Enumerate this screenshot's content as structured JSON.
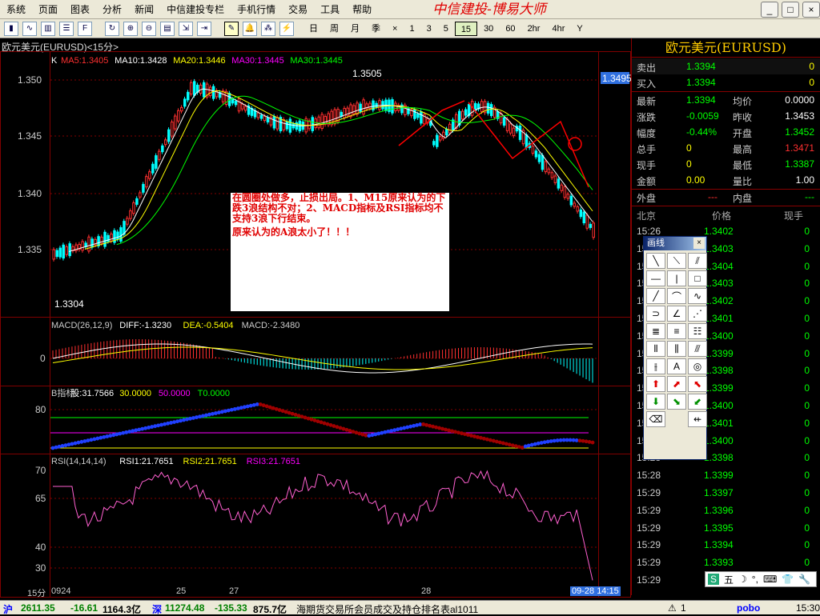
{
  "menu": [
    "系统",
    "页面",
    "图表",
    "分析",
    "新闻",
    "中信建投专栏",
    "手机行情",
    "交易",
    "工具",
    "帮助"
  ],
  "brand": "中信建投-博易大师",
  "window_buttons": [
    "_",
    "□",
    "×"
  ],
  "periods": [
    "日",
    "周",
    "月",
    "季",
    "×",
    "1",
    "3",
    "5",
    "15",
    "30",
    "60",
    "2hr",
    "4hr",
    "Y"
  ],
  "selected_period": "15",
  "chart": {
    "title": "欧元美元(EURUSD)<15分>",
    "ma_legend": [
      {
        "text": "K",
        "color": "#ffffff"
      },
      {
        "text": "MA5:1.3405",
        "color": "#ff3030"
      },
      {
        "text": "MA10:1.3428",
        "color": "#ffffff"
      },
      {
        "text": "MA20:1.3446",
        "color": "#ffff00"
      },
      {
        "text": "MA30:1.3445",
        "color": "#ff00ff"
      },
      {
        "text": "MA30:1.3445",
        "color": "#00ff00"
      }
    ],
    "price_axis": [
      "1.350",
      "1.345",
      "1.340",
      "1.335"
    ],
    "last_price_tag": "1.3495",
    "high_label": "1.3505",
    "low_label": "1.3304",
    "macd_legend": [
      {
        "text": "MACD(26,12,9)",
        "color": "#cccccc"
      },
      {
        "text": "DIFF:-1.3230",
        "color": "#ffffff"
      },
      {
        "text": "DEA:-0.5404",
        "color": "#ffff00"
      },
      {
        "text": "MACD:-2.3480",
        "color": "#cccccc"
      }
    ],
    "macd_axis": [
      "0"
    ],
    "b_legend": [
      {
        "text": "B指标",
        "color": "#cccccc"
      },
      {
        "text": "股:31.7566",
        "color": "#ffffff"
      },
      {
        "text": "30.0000",
        "color": "#ffff00"
      },
      {
        "text": "50.0000",
        "color": "#ff00ff"
      },
      {
        "text": "T0.0000",
        "color": "#00ff00"
      }
    ],
    "b_axis": [
      "80"
    ],
    "rsi_legend": [
      {
        "text": "RSI(14,14,14)",
        "color": "#cccccc"
      },
      {
        "text": "RSI1:21.7651",
        "color": "#ffffff"
      },
      {
        "text": "RSI2:21.7651",
        "color": "#ffff00"
      },
      {
        "text": "RSI3:21.7651",
        "color": "#ff00ff"
      }
    ],
    "rsi_axis": [
      "70",
      "65",
      "40",
      "30"
    ],
    "time_axis": {
      "period": "15分",
      "labels": [
        "0924",
        "25",
        "27",
        "28"
      ],
      "cursor": "09-28 14:15"
    }
  },
  "annotation": {
    "line1": "在圆圈处做多，止损出局。1、M15原来认为的下跌3浪结构不对；2、MACD指标及RSI指标均不支持3浪下行结束。",
    "line2": "原来认为的A浪太小了！！！"
  },
  "quote": {
    "title": "欧元美元(EURUSD)",
    "sell": {
      "label": "卖出",
      "price": "1.3394",
      "vol": "0"
    },
    "buy": {
      "label": "买入",
      "price": "1.3394",
      "vol": "0"
    },
    "rows": [
      [
        {
          "t": "最新",
          "c": "#cccccc"
        },
        {
          "t": "1.3394",
          "c": "#00ff00"
        },
        {
          "t": "均价",
          "c": "#cccccc"
        },
        {
          "t": "0.0000",
          "c": "#ffffff"
        }
      ],
      [
        {
          "t": "涨跌",
          "c": "#cccccc"
        },
        {
          "t": "-0.0059",
          "c": "#00ff00"
        },
        {
          "t": "昨收",
          "c": "#cccccc"
        },
        {
          "t": "1.3453",
          "c": "#ffffff"
        }
      ],
      [
        {
          "t": "幅度",
          "c": "#cccccc"
        },
        {
          "t": "-0.44%",
          "c": "#00ff00"
        },
        {
          "t": "开盘",
          "c": "#cccccc"
        },
        {
          "t": "1.3452",
          "c": "#00ff00"
        }
      ],
      [
        {
          "t": "总手",
          "c": "#cccccc"
        },
        {
          "t": "0",
          "c": "#ffff00"
        },
        {
          "t": "最高",
          "c": "#cccccc"
        },
        {
          "t": "1.3471",
          "c": "#ff3030"
        }
      ],
      [
        {
          "t": "现手",
          "c": "#cccccc"
        },
        {
          "t": "0",
          "c": "#ffff00"
        },
        {
          "t": "最低",
          "c": "#cccccc"
        },
        {
          "t": "1.3387",
          "c": "#00ff00"
        }
      ],
      [
        {
          "t": "金额",
          "c": "#cccccc"
        },
        {
          "t": "0.00",
          "c": "#ffff00"
        },
        {
          "t": "量比",
          "c": "#cccccc"
        },
        {
          "t": "1.00",
          "c": "#ffffff"
        }
      ]
    ],
    "outer": {
      "label": "外盘",
      "value": "---"
    },
    "inner": {
      "label": "内盘",
      "value": "---"
    },
    "tick_headers": [
      "北京",
      "价格",
      "现手"
    ],
    "ticks": [
      [
        "15:26",
        "1.3402",
        "0"
      ],
      [
        "15:26",
        "1.3403",
        "0"
      ],
      [
        "15:27",
        "1.3404",
        "0"
      ],
      [
        "15:27",
        "1.3403",
        "0"
      ],
      [
        "15:27",
        "1.3402",
        "0"
      ],
      [
        "15:27",
        "1.3401",
        "0"
      ],
      [
        "15:27",
        "1.3400",
        "0"
      ],
      [
        "15:27",
        "1.3399",
        "0"
      ],
      [
        "15:28",
        "1.3398",
        "0"
      ],
      [
        "15:28",
        "1.3399",
        "0"
      ],
      [
        "15:28",
        "1.3400",
        "0"
      ],
      [
        "15:28",
        "1.3401",
        "0"
      ],
      [
        "15:28",
        "1.3400",
        "0"
      ],
      [
        "15:28",
        "1.3398",
        "0"
      ],
      [
        "15:28",
        "1.3399",
        "0"
      ],
      [
        "15:29",
        "1.3397",
        "0"
      ],
      [
        "15:29",
        "1.3396",
        "0"
      ],
      [
        "15:29",
        "1.3395",
        "0"
      ],
      [
        "15:29",
        "1.3394",
        "0"
      ],
      [
        "15:29",
        "1.3393",
        "0"
      ],
      [
        "15:29",
        "",
        ""
      ]
    ]
  },
  "drawing_palette": {
    "title": "画线",
    "close": "×"
  },
  "status": {
    "sh_label": "沪",
    "sh_index": "2611.35",
    "sh_change": "-16.61",
    "sh_amount": "1164.3亿",
    "sz_label": "深",
    "sz_index": "11274.48",
    "sz_change": "-135.33",
    "sz_amount": "875.7亿",
    "ticker": "海期货交易所会员成交及持仓排名表al1011",
    "alert": "1",
    "pobo": "pobo",
    "time": "15:30"
  },
  "ime": {
    "label": "五"
  }
}
